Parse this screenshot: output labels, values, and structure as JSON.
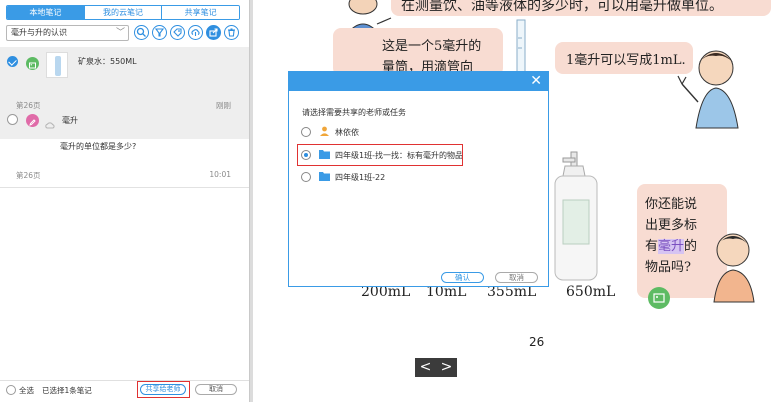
{
  "tabs": [
    "本地笔记",
    "我的云笔记",
    "共享笔记"
  ],
  "toolbar": {
    "select_value": "毫升与升的认识"
  },
  "notes": [
    {
      "title": "矿泉水：550ML",
      "page": "第26页",
      "time": "刚刚"
    },
    {
      "title": "毫升",
      "body": "毫升的单位都是多少?",
      "page": "第26页",
      "time": "10:01"
    }
  ],
  "bottom": {
    "select_all": "全选",
    "selected_count": "已选择1条笔记",
    "share_button": "共享给老师",
    "cancel_button": "取消"
  },
  "book": {
    "top_line": "在测量饮、油等液体的多少时，可以用毫升做单位。",
    "cylinder_line1": "这是一个5毫升的",
    "cylinder_line2": "量筒，用滴管向",
    "ml_text": "1毫升可以写成1mL.",
    "bubble_lines": [
      "你还能说",
      "出更多标",
      "有",
      "毫升",
      "的",
      "物品吗?"
    ],
    "capacities": [
      "200mL",
      "10mL",
      "355mL",
      "650mL"
    ],
    "page_number": "26",
    "prev": "<",
    "next": ">"
  },
  "modal": {
    "close": "✕",
    "prompt": "请选择需要共享的老师或任务",
    "options": [
      "林依依",
      "四年级1班-找一找：标有毫升的物品",
      "四年级1班-22"
    ],
    "ok": "确认",
    "cancel": "取消"
  },
  "colors": {
    "accent": "#3a9be6",
    "highlight": "#e03232",
    "bubble": "#f8dcd2"
  }
}
